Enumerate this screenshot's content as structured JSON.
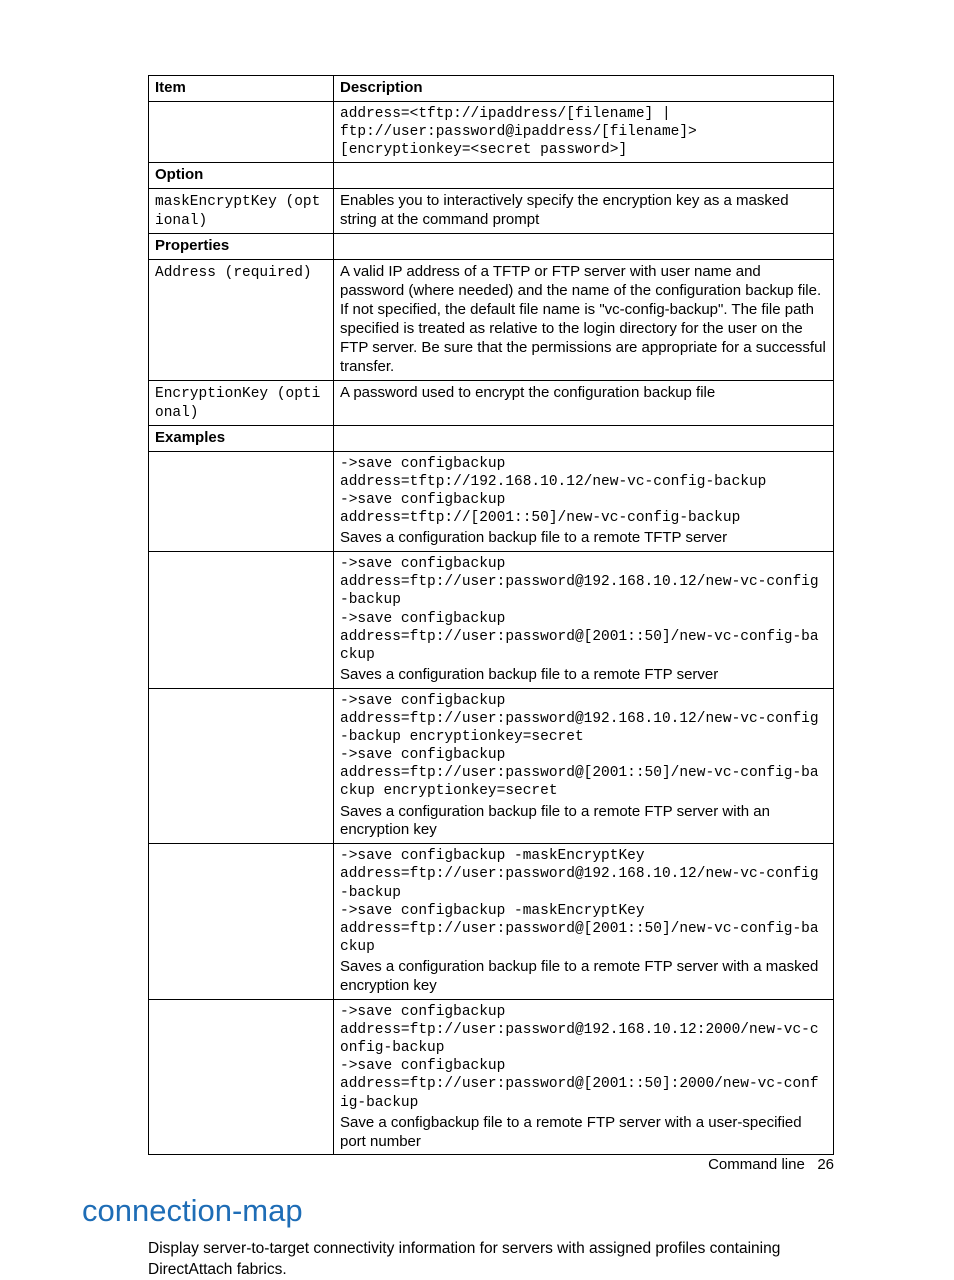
{
  "table": {
    "header": {
      "item": "Item",
      "desc": "Description"
    },
    "row_syntax": {
      "code": "address=<tftp://ipaddress/[filename] |\nftp://user:password@ipaddress/[filename]>\n[encryptionkey=<secret password>]"
    },
    "section_option": "Option",
    "row_mask": {
      "item_code": "maskEncryptKey (optional)",
      "desc": "Enables you to interactively specify the encryption key as a masked string at the command prompt"
    },
    "section_properties": "Properties",
    "row_address": {
      "item_code": "Address (required)",
      "desc": "A valid IP address of a TFTP or FTP server with user name and password (where needed) and the name of the configuration backup file. If not specified, the default file name is \"vc-config-backup\". The file path specified is treated as relative to the login directory for the user on the FTP server. Be sure that the permissions are appropriate for a successful transfer."
    },
    "row_enckey": {
      "item_code": "EncryptionKey (optional)",
      "desc": "A password used to encrypt the configuration backup file"
    },
    "section_examples": "Examples",
    "ex1": {
      "code": "->save configbackup\naddress=tftp://192.168.10.12/new-vc-config-backup\n->save configbackup\naddress=tftp://[2001::50]/new-vc-config-backup",
      "caption": "Saves a configuration backup file to a remote TFTP server"
    },
    "ex2": {
      "code": "->save configbackup\naddress=ftp://user:password@192.168.10.12/new-vc-config-backup\n->save configbackup\naddress=ftp://user:password@[2001::50]/new-vc-config-backup",
      "caption": "Saves a configuration backup file to a remote FTP server"
    },
    "ex3": {
      "code": "->save configbackup\naddress=ftp://user:password@192.168.10.12/new-vc-config-backup encryptionkey=secret\n->save configbackup\naddress=ftp://user:password@[2001::50]/new-vc-config-backup encryptionkey=secret",
      "caption": "Saves a configuration backup file to a remote FTP server with an encryption key"
    },
    "ex4": {
      "code": "->save configbackup -maskEncryptKey\naddress=ftp://user:password@192.168.10.12/new-vc-config-backup\n->save configbackup -maskEncryptKey\naddress=ftp://user:password@[2001::50]/new-vc-config-backup",
      "caption": "Saves a configuration backup file to a remote FTP server with a masked encryption key"
    },
    "ex5": {
      "code": "->save configbackup\naddress=ftp://user:password@192.168.10.12:2000/new-vc-config-backup\n->save configbackup\naddress=ftp://user:password@[2001::50]:2000/new-vc-config-backup",
      "caption": "Save a configbackup file to a remote FTP server with a user-specified port number"
    }
  },
  "heading": "connection-map",
  "body_paragraph": "Display server-to-target connectivity information for servers with assigned profiles containing DirectAttach fabrics.",
  "footer": {
    "label": "Command line",
    "page": "26"
  }
}
